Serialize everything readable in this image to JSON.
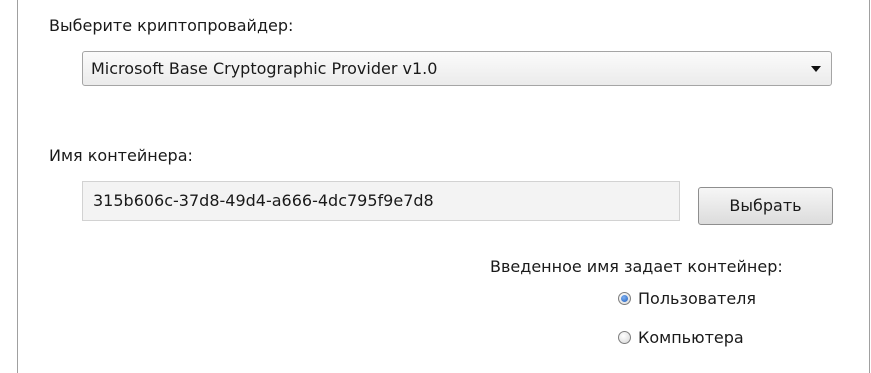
{
  "provider": {
    "label": "Выберите криптопровайдер:",
    "selected": "Microsoft Base Cryptographic Provider v1.0"
  },
  "container": {
    "label": "Имя контейнера:",
    "value": "315b606c-37d8-49d4-a666-4dc795f9e7d8",
    "choose_button": "Выбрать"
  },
  "owner": {
    "label": "Введенное имя задает контейнер:",
    "options": [
      {
        "label": "Пользователя",
        "checked": true
      },
      {
        "label": "Компьютера",
        "checked": false
      }
    ]
  }
}
